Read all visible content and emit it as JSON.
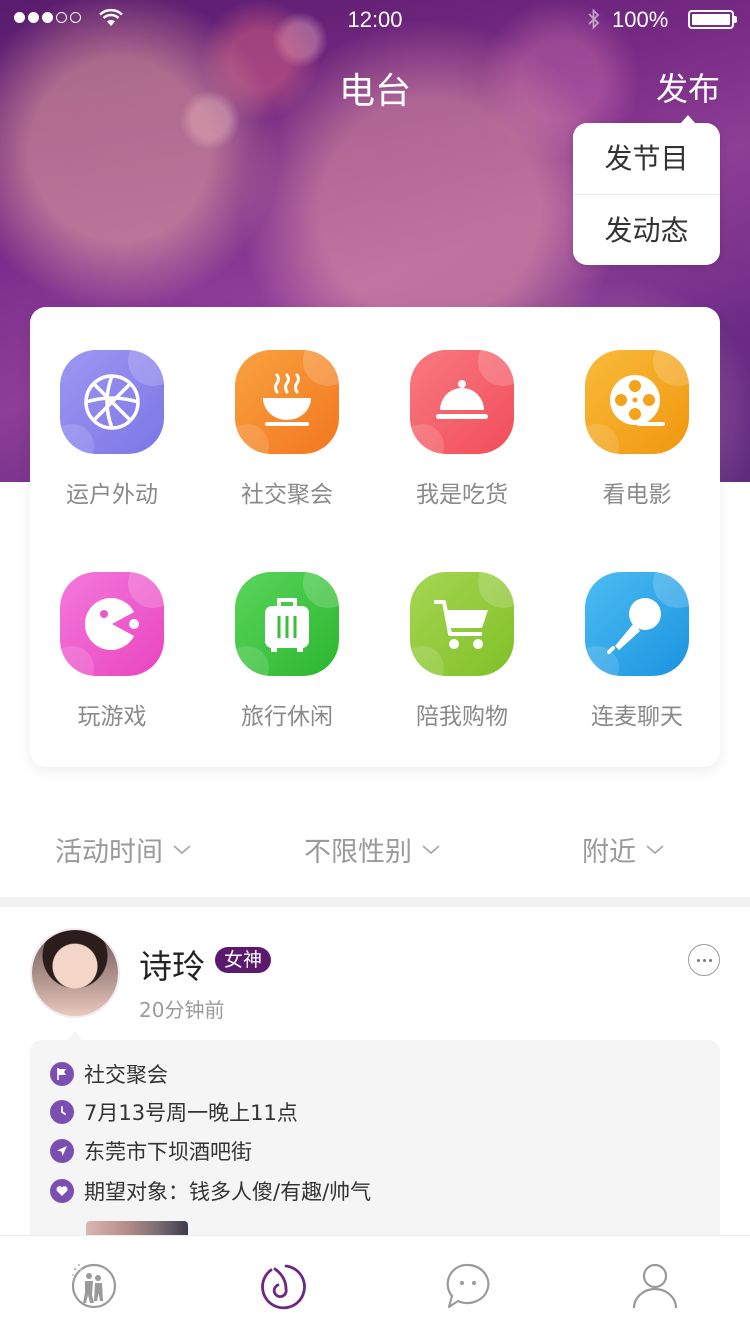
{
  "status_bar": {
    "time": "12:00",
    "battery": "100%",
    "signal_dots_on": 3,
    "signal_dots_total": 5
  },
  "nav": {
    "title": "电台",
    "publish_label": "发布",
    "publish_menu": [
      "发节目",
      "发动态"
    ]
  },
  "categories": [
    {
      "label": "运户外动",
      "icon": "basketball-icon",
      "color": "#8c86ec"
    },
    {
      "label": "社交聚会",
      "icon": "steaming-bowl-icon",
      "color": "#f68b2c"
    },
    {
      "label": "我是吃货",
      "icon": "food-cloche-icon",
      "color": "#f5606a"
    },
    {
      "label": "看电影",
      "icon": "film-reel-icon",
      "color": "#f6ab22"
    },
    {
      "label": "玩游戏",
      "icon": "pacman-icon",
      "color": "#ef5ccc"
    },
    {
      "label": "旅行休闲",
      "icon": "luggage-icon",
      "color": "#3cc63e"
    },
    {
      "label": "陪我购物",
      "icon": "shopping-cart-icon",
      "color": "#93cb3c"
    },
    {
      "label": "连麦聊天",
      "icon": "microphone-icon",
      "color": "#2da8ea"
    }
  ],
  "filters": [
    "活动时间",
    "不限性别",
    "附近"
  ],
  "post": {
    "user_name": "诗玲",
    "badge": "女神",
    "time_ago": "20分钟前",
    "details": [
      {
        "icon": "flag-icon",
        "text": "社交聚会"
      },
      {
        "icon": "clock-icon",
        "text": "7月13号周一晚上11点"
      },
      {
        "icon": "location-arrow-icon",
        "text": "东莞市下坝酒吧街"
      },
      {
        "icon": "heart-icon",
        "text": "期望对象：钱多人傻/有趣/帅气"
      }
    ]
  },
  "tabbar": {
    "items": [
      "home-couple-icon",
      "radio-icon",
      "chat-icon",
      "profile-icon"
    ],
    "active_index": 1,
    "active_color": "#6d2683",
    "inactive_color": "#9a9a9a"
  }
}
